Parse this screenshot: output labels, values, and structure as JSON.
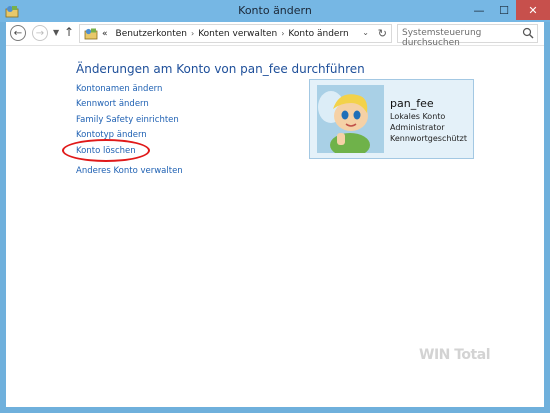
{
  "window": {
    "title": "Konto ändern",
    "minimize_glyph": "—",
    "maximize_glyph": "☐",
    "close_glyph": "✕"
  },
  "nav": {
    "back_glyph": "←",
    "forward_glyph": "→",
    "dropdown_glyph": "▼",
    "up_glyph": "↑"
  },
  "address_bar": {
    "icon": "control-panel-icon",
    "crumb_prefix": "«",
    "crumbs": [
      "Benutzerkonten",
      "Konten verwalten",
      "Konto ändern"
    ],
    "separator": "›",
    "dropdown_glyph": "⌄",
    "refresh_glyph": "↻"
  },
  "search": {
    "placeholder": "Systemsteuerung durchsuchen"
  },
  "main": {
    "heading": "Änderungen am Konto von pan_fee durchführen",
    "links": [
      "Kontonamen ändern",
      "Kennwort ändern",
      "Family Safety einrichten",
      "Kontotyp ändern",
      "Konto löschen",
      "Anderes Konto verwalten"
    ],
    "highlight_color": "#e01919"
  },
  "account": {
    "name": "pan_fee",
    "type": "Lokales Konto",
    "role": "Administrator",
    "protection": "Kennwortgeschützt"
  },
  "watermark": "WIN Total",
  "colors": {
    "titlebar": "#76b7e4",
    "link": "#1f61b3",
    "heading": "#1e4f9a",
    "close_button": "#c7504c",
    "card_bg": "#e4f1f9"
  }
}
